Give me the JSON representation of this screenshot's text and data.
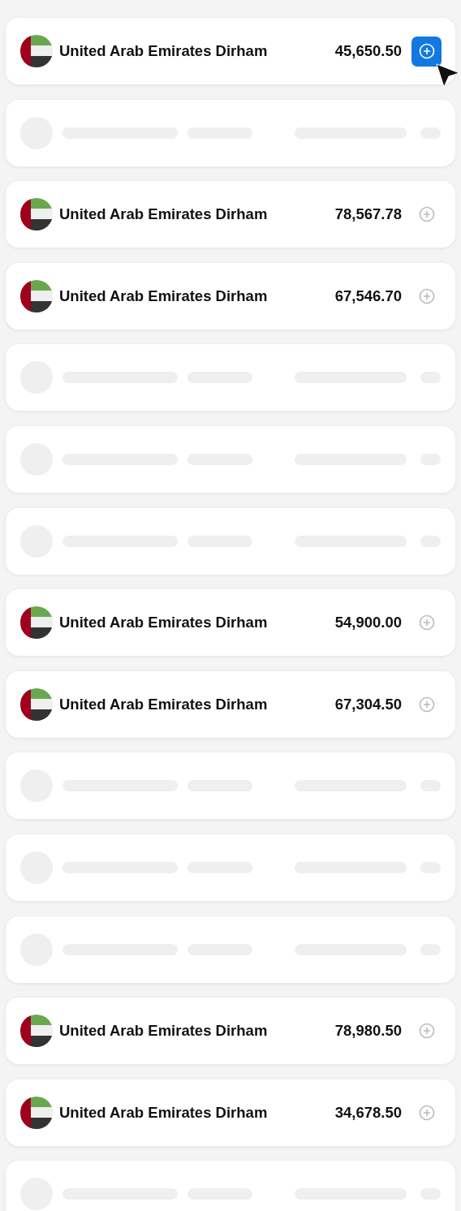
{
  "rows": [
    {
      "kind": "currency",
      "name": "United Arab Emirates Dirham",
      "amount": "45,650.50",
      "selected": true
    },
    {
      "kind": "skeleton"
    },
    {
      "kind": "currency",
      "name": "United Arab Emirates Dirham",
      "amount": "78,567.78",
      "selected": false
    },
    {
      "kind": "currency",
      "name": "United Arab Emirates Dirham",
      "amount": "67,546.70",
      "selected": false
    },
    {
      "kind": "skeleton"
    },
    {
      "kind": "skeleton"
    },
    {
      "kind": "skeleton"
    },
    {
      "kind": "currency",
      "name": "United Arab Emirates Dirham",
      "amount": "54,900.00",
      "selected": false
    },
    {
      "kind": "currency",
      "name": "United Arab Emirates Dirham",
      "amount": "67,304.50",
      "selected": false
    },
    {
      "kind": "skeleton"
    },
    {
      "kind": "skeleton"
    },
    {
      "kind": "skeleton"
    },
    {
      "kind": "currency",
      "name": "United Arab Emirates Dirham",
      "amount": "78,980.50",
      "selected": false
    },
    {
      "kind": "currency",
      "name": "United Arab Emirates Dirham",
      "amount": "34,678.50",
      "selected": false
    },
    {
      "kind": "skeleton"
    }
  ]
}
